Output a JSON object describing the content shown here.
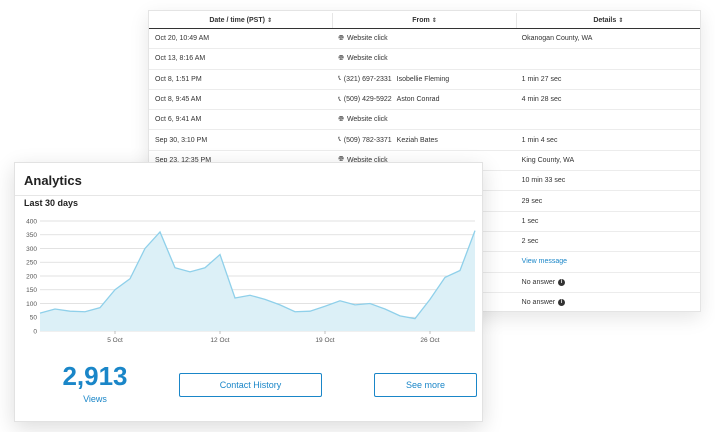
{
  "table": {
    "headers": {
      "date": "Date / time (PST)",
      "from": "From",
      "details": "Details",
      "sort_glyph": "⇕"
    },
    "rows": [
      {
        "date": "Oct 20, 10:49 AM",
        "from_icon": "globe-icon",
        "from": "Website click",
        "phone": "",
        "name": "",
        "details": "Okanogan County, WA",
        "details_type": "text"
      },
      {
        "date": "Oct 13, 8:16 AM",
        "from_icon": "globe-icon",
        "from": "Website click",
        "phone": "",
        "name": "",
        "details": "",
        "details_type": "text"
      },
      {
        "date": "Oct 8, 1:51 PM",
        "from_icon": "phone-icon",
        "from": "",
        "phone": "(321) 697-2331",
        "name": "Isobellie Fleming",
        "details": "1 min 27 sec",
        "details_type": "text"
      },
      {
        "date": "Oct 8, 9:45 AM",
        "from_icon": "phone-icon",
        "from": "",
        "phone": "(509) 429-5922",
        "name": "Aston Conrad",
        "details": "4 min 28 sec",
        "details_type": "text"
      },
      {
        "date": "Oct 6, 9:41 AM",
        "from_icon": "globe-icon",
        "from": "Website click",
        "phone": "",
        "name": "",
        "details": "",
        "details_type": "text"
      },
      {
        "date": "Sep 30, 3:10 PM",
        "from_icon": "phone-icon",
        "from": "",
        "phone": "(509) 782-3371",
        "name": "Keziah Bates",
        "details": "1 min 4 sec",
        "details_type": "text"
      },
      {
        "date": "Sep 23, 12:35 PM",
        "from_icon": "globe-icon",
        "from": "Website click",
        "phone": "",
        "name": "",
        "details": "King County, WA",
        "details_type": "text"
      },
      {
        "date": "",
        "from_icon": "",
        "from": "",
        "phone": "",
        "name": "",
        "details": "10 min 33 sec",
        "details_type": "text"
      },
      {
        "date": "",
        "from_icon": "",
        "from": "",
        "phone": "",
        "name": "",
        "details": "29 sec",
        "details_type": "text"
      },
      {
        "date": "",
        "from_icon": "",
        "from": "",
        "phone": "",
        "name": "",
        "details": "1 sec",
        "details_type": "text"
      },
      {
        "date": "",
        "from_icon": "",
        "from": "",
        "phone": "",
        "name": "",
        "details": "2 sec",
        "details_type": "text"
      },
      {
        "date": "",
        "from_icon": "",
        "from": "",
        "phone": "",
        "name": "",
        "details": "View message",
        "details_type": "link"
      },
      {
        "date": "",
        "from_icon": "",
        "from": "",
        "phone": "",
        "name": "",
        "details": "No answer",
        "details_type": "no-answer"
      },
      {
        "date": "",
        "from_icon": "",
        "from": "",
        "phone": "",
        "name": "",
        "details": "No answer",
        "details_type": "no-answer"
      }
    ]
  },
  "analytics": {
    "title": "Analytics",
    "subtitle": "Last 30 days",
    "views_count": "2,913",
    "views_label": "Views",
    "contact_history_label": "Contact History",
    "see_more_label": "See more"
  },
  "colors": {
    "accent": "#1a86c8",
    "area_fill": "#dcf0f7",
    "area_line": "#8fd0ea"
  },
  "chart_data": {
    "type": "area",
    "x_tick_labels": [
      "5 Oct",
      "12 Oct",
      "19 Oct",
      "26 Oct"
    ],
    "x_tick_index": [
      5,
      12,
      19,
      26
    ],
    "ylim": [
      0,
      400
    ],
    "y_ticks": [
      0,
      50,
      100,
      150,
      200,
      250,
      300,
      350,
      400
    ],
    "grid": true,
    "series": [
      {
        "values": [
          65,
          80,
          72,
          70,
          85,
          150,
          190,
          300,
          360,
          230,
          215,
          230,
          278,
          120,
          130,
          115,
          95,
          70,
          72,
          90,
          110,
          95,
          100,
          80,
          55,
          45,
          115,
          195,
          220,
          365
        ]
      }
    ]
  }
}
